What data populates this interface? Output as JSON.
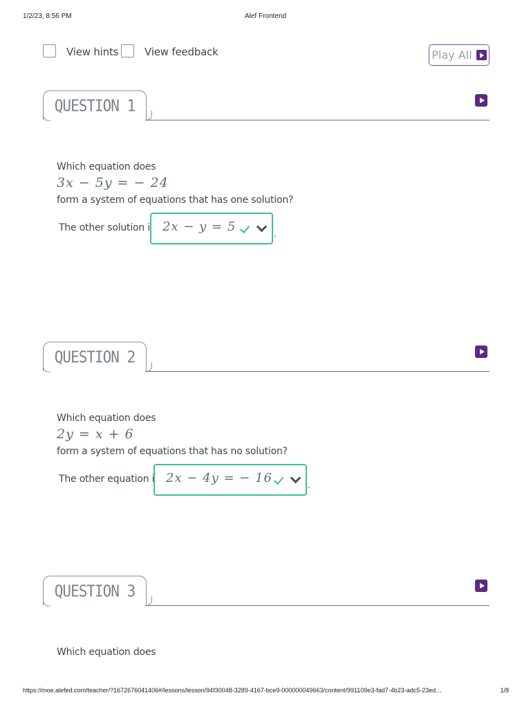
{
  "print": {
    "date": "1/2/23, 8:56 PM",
    "title": "Alef Frontend",
    "url": "https://moe.alefed.com/teacher/?1672676041406#/lessons/lesson/94f30048-3289-4167-bce9-000000049663/content/991109e3-fad7-4b23-adc5-23ed…",
    "page": "1/8"
  },
  "toolbar": {
    "view_hints_label": "View hints",
    "view_feedback_label": "View feedback",
    "play_all_label": "Play All"
  },
  "questions": [
    {
      "heading": "QUESTION 1",
      "prompt": "Which equation does",
      "equation": "3x − 5y = − 24",
      "followup": "form a system of equations that has one solution?",
      "answer_label": "The other solution is",
      "answer_value": "2x − y = 5",
      "answer_status": "correct"
    },
    {
      "heading": "QUESTION 2",
      "prompt": "Which equation does",
      "equation": "2y = x + 6",
      "followup": "form a system of equations that has no solution?",
      "answer_label": "The other equation is",
      "answer_value": "2x − 4y = − 16",
      "answer_status": "correct"
    },
    {
      "heading": "QUESTION 3",
      "prompt": "Which equation does"
    }
  ],
  "colors": {
    "accent_purple": "#5b2b82",
    "correct_green": "#3cbf9c",
    "tab_border": "#8a8f96"
  },
  "icons": {
    "play": "play-icon",
    "correct": "checkmark-icon",
    "dropdown": "chevron-down-icon"
  }
}
